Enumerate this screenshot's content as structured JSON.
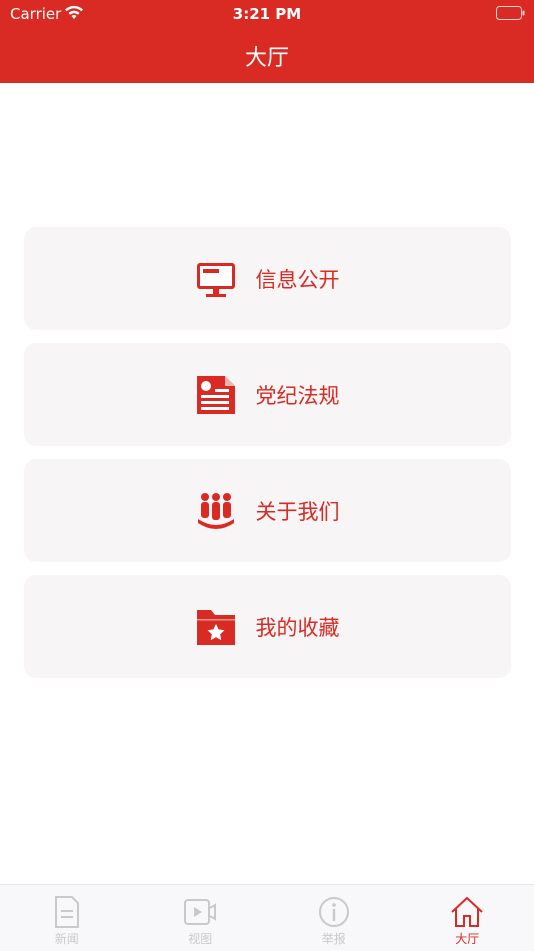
{
  "status_bar": {
    "carrier": "Carrier",
    "time": "3:21 PM"
  },
  "nav": {
    "title": "大厅"
  },
  "menu": {
    "items": [
      {
        "label": "信息公开",
        "icon": "monitor-icon"
      },
      {
        "label": "党纪法规",
        "icon": "party-document-icon"
      },
      {
        "label": "关于我们",
        "icon": "people-group-icon"
      },
      {
        "label": "我的收藏",
        "icon": "star-folder-icon"
      }
    ]
  },
  "tabbar": {
    "items": [
      {
        "label": "新闻",
        "icon": "document-icon",
        "active": false
      },
      {
        "label": "视图",
        "icon": "video-icon",
        "active": false
      },
      {
        "label": "举报",
        "icon": "info-icon",
        "active": false
      },
      {
        "label": "大厅",
        "icon": "home-icon",
        "active": true
      }
    ]
  },
  "colors": {
    "brand": "#d92b24",
    "card_bg": "#f7f5f5",
    "tab_inactive": "#c9c9c9"
  }
}
